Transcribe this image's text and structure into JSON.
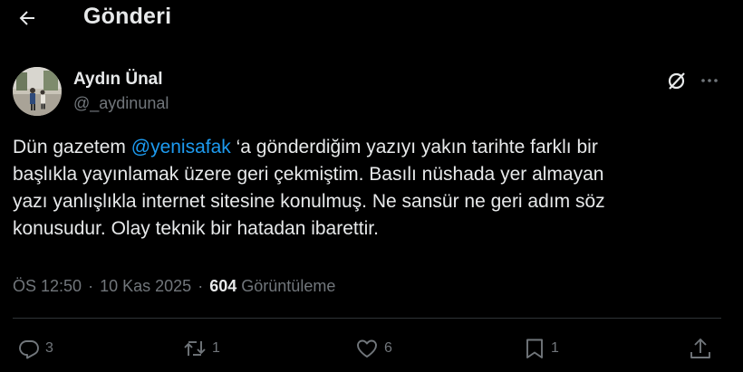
{
  "header": {
    "title": "Gönderi",
    "back_icon": "arrow-left-icon"
  },
  "author": {
    "name": "Aydın Ünal",
    "handle": "@_aydinunal"
  },
  "tweet": {
    "line1_pre": "Dün gazetem ",
    "mention": "@yenisafak",
    "line1_post": " ‘a gönderdiğim yazıyı yakın tarihte farklı bir",
    "line2": "başlıkla yayınlamak üzere geri çekmiştim. Basılı nüshada yer almayan",
    "line3": "yazı yanlışlıkla internet sitesine konulmuş.  Ne sansür ne geri adım söz",
    "line4": "konusudur. Olay teknik bir hatadan ibarettir."
  },
  "meta": {
    "time": "ÖS 12:50",
    "separator": "·",
    "date": "10 Kas 2025",
    "views_count": "604",
    "views_label": "Görüntüleme"
  },
  "actions": {
    "reply_count": "3",
    "retweet_count": "1",
    "like_count": "6",
    "bookmark_count": "1"
  },
  "colors": {
    "background": "#000000",
    "text": "#e7e9ea",
    "secondary": "#71767b",
    "accent": "#1d9bf0",
    "divider": "#2f3336"
  }
}
